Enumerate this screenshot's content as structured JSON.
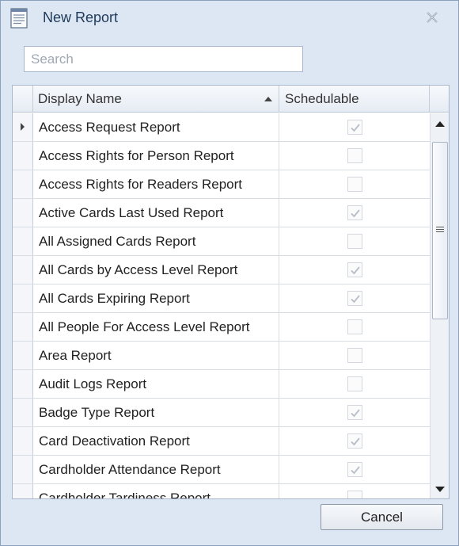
{
  "window": {
    "title": "New Report"
  },
  "search": {
    "placeholder": "Search",
    "value": ""
  },
  "grid": {
    "columns": {
      "display_name": "Display Name",
      "schedulable": "Schedulable"
    },
    "sort": {
      "column": "display_name",
      "direction": "ascending"
    },
    "rows": [
      {
        "name": "Access Request Report",
        "schedulable": true
      },
      {
        "name": "Access Rights for Person Report",
        "schedulable": false
      },
      {
        "name": "Access Rights for Readers Report",
        "schedulable": false
      },
      {
        "name": "Active Cards Last Used Report",
        "schedulable": true
      },
      {
        "name": "All Assigned Cards Report",
        "schedulable": false
      },
      {
        "name": "All Cards by Access Level Report",
        "schedulable": true
      },
      {
        "name": "All Cards Expiring Report",
        "schedulable": true
      },
      {
        "name": "All People For Access Level Report",
        "schedulable": false
      },
      {
        "name": "Area Report",
        "schedulable": false
      },
      {
        "name": "Audit Logs Report",
        "schedulable": false
      },
      {
        "name": "Badge Type Report",
        "schedulable": true
      },
      {
        "name": "Card Deactivation Report",
        "schedulable": true
      },
      {
        "name": "Cardholder Attendance Report",
        "schedulable": true
      },
      {
        "name": "Cardholder Tardiness Report",
        "schedulable": false
      }
    ],
    "current_row": 0
  },
  "footer": {
    "cancel_label": "Cancel"
  },
  "colors": {
    "window_bg": "#dde7f3",
    "title_text": "#1e3a5a",
    "check_disabled": "#b8bec7"
  },
  "icons": {
    "app": "report-document-icon",
    "close": "close-icon"
  }
}
